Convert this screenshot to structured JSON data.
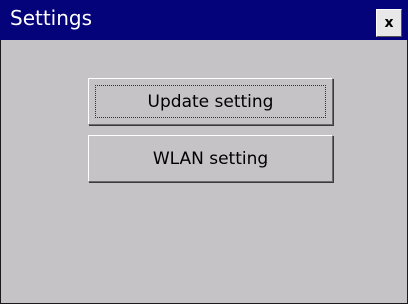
{
  "window": {
    "title": "Settings",
    "close_label": "x"
  },
  "buttons": {
    "update_label": "Update setting",
    "wlan_label": "WLAN setting"
  },
  "colors": {
    "titlebar": "#04037a",
    "background": "#c6c3c6",
    "title_text": "#ffffff"
  },
  "icons": {
    "close": "close-icon"
  }
}
